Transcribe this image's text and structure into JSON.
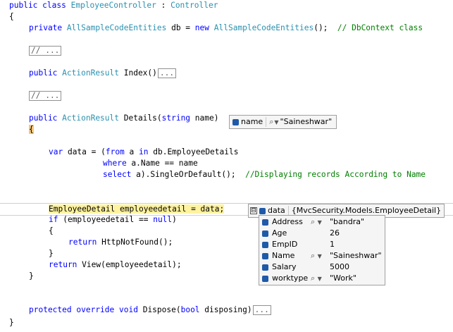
{
  "code": {
    "l1": {
      "kw1": "public",
      "kw2": "class",
      "name": "EmployeeController",
      "colon": " : ",
      "base": "Controller"
    },
    "l2": "{",
    "l3": {
      "kw": "private",
      "type": "AllSampleCodeEntities",
      "mid": " db = ",
      "kw2": "new",
      "type2": "AllSampleCodeEntities",
      "end": "();  ",
      "comment": "// DbContext class"
    },
    "l4": "// ...",
    "l5": {
      "kw": "public",
      "type": "ActionResult",
      "name": " Index()",
      "collapsed": "..."
    },
    "l6": "// ...",
    "l7": {
      "kw": "public",
      "type": "ActionResult",
      "name": " Details(",
      "kw2": "string",
      "end": " name)"
    },
    "l8": "{",
    "l9": {
      "kw": "var",
      "a": " data = (",
      "kw2": "from",
      "b": " a ",
      "kw3": "in",
      "c": " db.EmployeeDetails"
    },
    "l10": {
      "kw": "where",
      "rest": " a.Name == name"
    },
    "l11": {
      "kw": "select",
      "rest": " a).SingleOrDefault();  ",
      "comment": "//Displaying records According to Name"
    },
    "l12": {
      "type": "EmployeeDetail",
      "rest": " employeedetail = data;"
    },
    "l13": {
      "kw": "if",
      "rest": " (employeedetail == ",
      "kw2": "null",
      "end": ")"
    },
    "l14": "{",
    "l15": {
      "kw": "return",
      "rest": " HttpNotFound();"
    },
    "l16": "}",
    "l17": {
      "kw": "return",
      "rest": " View(employeedetail);"
    },
    "l18": "}",
    "l19": {
      "kw1": "protected",
      "kw2": "override",
      "kw3": "void",
      "rest": " Dispose(",
      "kw4": "bool",
      "end": " disposing)",
      "collapsed": "..."
    },
    "l20": "}"
  },
  "name_tip": {
    "label": "name",
    "value": "\"Saineshwar\"",
    "icon": "variable-cube-icon"
  },
  "data_tip": {
    "label": "data",
    "value": "{MvcSecurity.Models.EmployeeDetail}",
    "expand": "⊟"
  },
  "properties": [
    {
      "name": "Address",
      "value": "\"bandra\"",
      "visualizer": true
    },
    {
      "name": "Age",
      "value": "26",
      "visualizer": false
    },
    {
      "name": "EmpID",
      "value": "1",
      "visualizer": false
    },
    {
      "name": "Name",
      "value": "\"Saineshwar\"",
      "visualizer": true
    },
    {
      "name": "Salary",
      "value": "5000",
      "visualizer": false
    },
    {
      "name": "worktype",
      "value": "\"Work\"",
      "visualizer": true
    }
  ],
  "colors": {
    "keyword": "#0000ff",
    "type": "#2b91af",
    "comment": "#008000",
    "string": "#a31515",
    "exec_highlight": "#fff3a0"
  }
}
